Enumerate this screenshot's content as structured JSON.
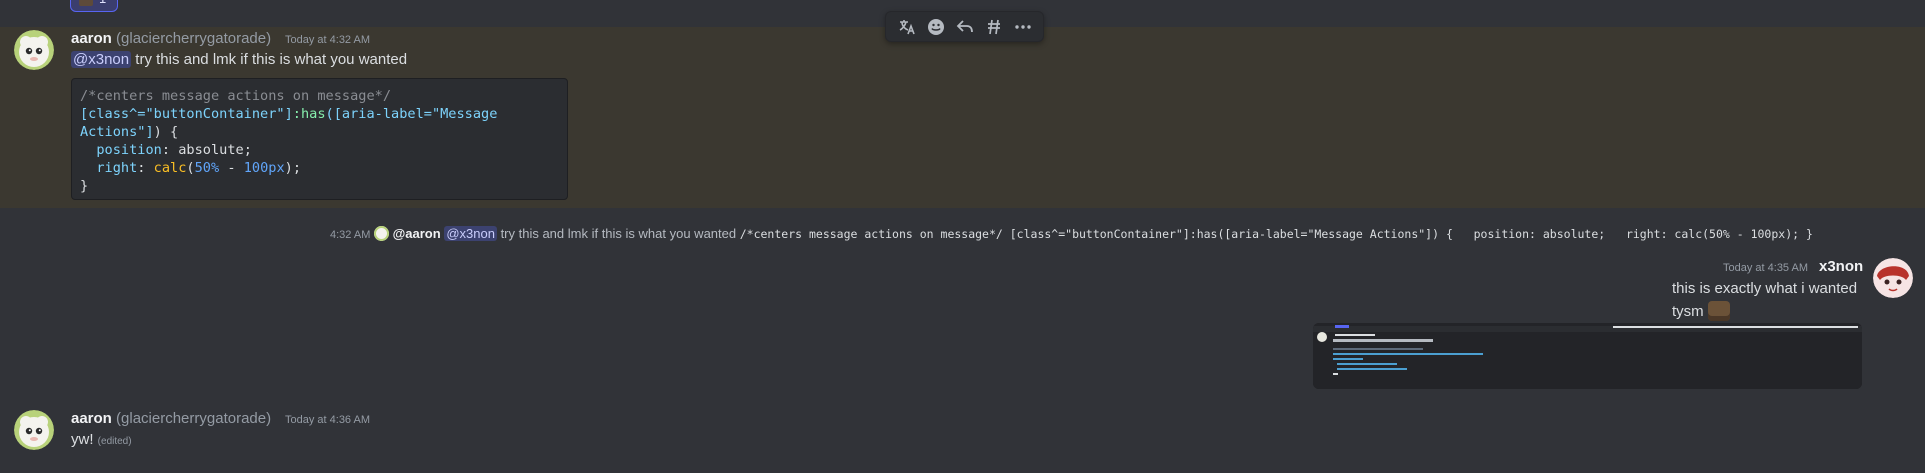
{
  "colors": {
    "background": "#313338",
    "highlight": "#3b3830",
    "mention_bg": "#3c4270",
    "mention_text": "#c9cdfb",
    "code_bg": "#2b2d31"
  },
  "top_reaction": {
    "count": "1"
  },
  "toolbar": {
    "icons": [
      "translate-icon",
      "add-reaction-icon",
      "reply-icon",
      "thread-icon",
      "more-icon"
    ]
  },
  "message1": {
    "author": "aaron",
    "handle": "(glaciercherrygatorade)",
    "timestamp": "Today at 4:32 AM",
    "mention": "@x3non",
    "text": "try this and lmk if this is what you wanted",
    "code": {
      "line1": "/*centers message actions on message*/",
      "line2_a": "[class^=\"buttonContainer\"]",
      "line2_b": ":has",
      "line2_c": "([aria-label=\"Message",
      "line3_a": "Actions\"]",
      "line3_b": ") {",
      "line4_prop": "position",
      "line4_val": ": absolute;",
      "line5_prop": "right",
      "line5_sep": ": ",
      "line5_calc": "calc",
      "line5_open": "(",
      "line5_n1": "50%",
      "line5_minus": " - ",
      "line5_n2": "100px",
      "line5_close": ");",
      "line6": "}"
    }
  },
  "reply_preview": {
    "time": "4:32 AM",
    "author": "@aaron",
    "mention": "@x3non",
    "text": "try this and lmk if this is what you wanted",
    "code": "/*centers message actions on message*/ [class^=\"buttonContainer\"]:has([aria-label=\"Message Actions\"]) {   position: absolute;   right: calc(50% - 100px); }"
  },
  "message2": {
    "timestamp": "Today at 4:35 AM",
    "author": "x3non",
    "line1": "this is exactly what i wanted",
    "line2": "tysm"
  },
  "message3": {
    "author": "aaron",
    "handle": "(glaciercherrygatorade)",
    "timestamp": "Today at 4:36 AM",
    "text": "yw!",
    "edited": "(edited)"
  }
}
